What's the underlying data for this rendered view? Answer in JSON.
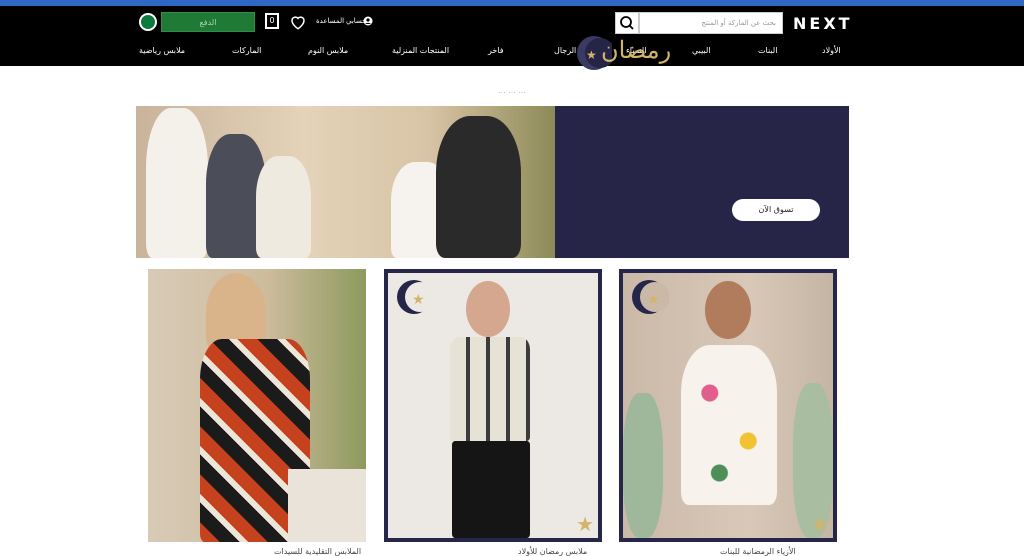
{
  "header": {
    "logo": "NEXT",
    "search_placeholder": "بحث عن الماركة أو المنتج",
    "checkout_label": "الدفع",
    "bag_count": "0",
    "help_label": "المساعدة",
    "account_label": "حسابي"
  },
  "nav": {
    "items": [
      "الأولاد",
      "البنات",
      "البيبي",
      "النساء",
      "الرجال",
      "فاخر",
      "المنتجات المنزلية",
      "ملابس النوم",
      "الماركات",
      "ملابس رياضية"
    ]
  },
  "promo": {
    "text": "... ... ..."
  },
  "hero": {
    "title": "رمضان",
    "button": "تسوق الآن"
  },
  "cards": [
    {
      "caption": "الملابس التقليدية للسيدات"
    },
    {
      "caption": "ملابس رمضان للأولاد"
    },
    {
      "caption": "الأزياء الرمضانية للبنات"
    }
  ],
  "colors": {
    "header_bg": "#000000",
    "accent_green": "#1e7a35",
    "hero_panel": "#262548",
    "gold": "#d2b46a"
  }
}
